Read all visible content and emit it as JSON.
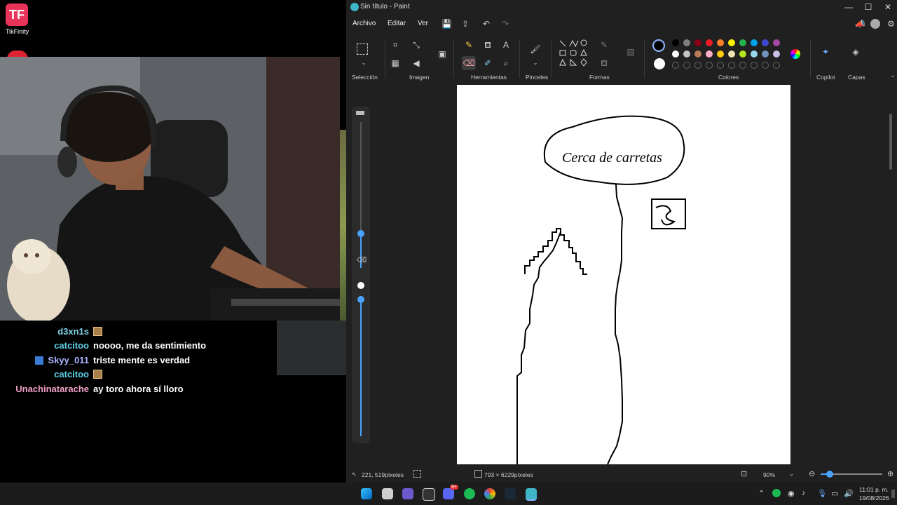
{
  "overlay": {
    "tikfinity_label": "TikFinity",
    "tikfinity_logo_text": "TF"
  },
  "chat": [
    {
      "user": "d3xn1s",
      "user_color": "#7fd2e8",
      "message": "",
      "emote": true,
      "badge": false
    },
    {
      "user": "catcitoo",
      "user_color": "#5fd0e8",
      "message": "noooo, me da sentimiento",
      "emote": false,
      "badge": false
    },
    {
      "user": "Skyy_011",
      "user_color": "#a9b6ff",
      "message": "triste mente es verdad",
      "emote": false,
      "badge": true
    },
    {
      "user": "catcitoo",
      "user_color": "#5fd0e8",
      "message": "",
      "emote": true,
      "badge": false
    },
    {
      "user": "Unachinatarache",
      "user_color": "#f0a0c8",
      "message": "ay toro ahora sí lloro",
      "emote": false,
      "badge": false
    }
  ],
  "paint": {
    "title": "Sin título - Paint",
    "menu": [
      "Archivo",
      "Editar",
      "Ver"
    ],
    "groups": {
      "seleccion": "Selección",
      "imagen": "Imagen",
      "herramientas": "Herramientas",
      "pinceles": "Pinceles",
      "formas": "Formas",
      "colores": "Colores",
      "copilot": "Copilot",
      "capas": "Capas"
    },
    "palette_row1": [
      "#000000",
      "#7f7f7f",
      "#880015",
      "#ed1c24",
      "#ff7f27",
      "#fff200",
      "#22b14c",
      "#00a2e8",
      "#3f48cc",
      "#a349a4"
    ],
    "palette_row2": [
      "#ffffff",
      "#c3c3c3",
      "#b97a57",
      "#ffaec9",
      "#ffc90e",
      "#efe4b0",
      "#b5e61d",
      "#99d9ea",
      "#7092be",
      "#c8bfe7"
    ],
    "primary_color": "#000000",
    "secondary_color": "#ffffff",
    "canvas_text": "Cerca de carretas",
    "status": {
      "cursor": "221, 519píxeles",
      "size": "793 × 6229píxeles",
      "zoom": "90%"
    }
  },
  "taskbar": {
    "time": "11:01 p. m.",
    "date": "19/08/2026",
    "discord_badge": "9+"
  }
}
